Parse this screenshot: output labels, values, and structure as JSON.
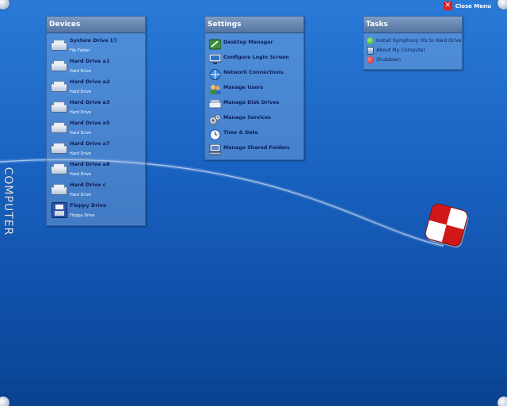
{
  "close_menu": {
    "label": "Close Menu"
  },
  "side_label": "COMPUTER",
  "devices": {
    "title": "Devices",
    "items": [
      {
        "name": "System Drive (/)",
        "sub": "File Folder",
        "icon": "hard-drive-icon"
      },
      {
        "name": "Hard Drive a1",
        "sub": "Hard Drive",
        "icon": "hard-drive-icon"
      },
      {
        "name": "Hard Drive a2",
        "sub": "Hard Drive",
        "icon": "hard-drive-icon"
      },
      {
        "name": "Hard Drive a3",
        "sub": "Hard Drive",
        "icon": "hard-drive-icon"
      },
      {
        "name": "Hard Drive a5",
        "sub": "Hard Drive",
        "icon": "hard-drive-icon"
      },
      {
        "name": "Hard Drive a7",
        "sub": "Hard Drive",
        "icon": "hard-drive-icon"
      },
      {
        "name": "Hard Drive a8",
        "sub": "Hard Drive",
        "icon": "hard-drive-icon"
      },
      {
        "name": "Hard Drive c",
        "sub": "Hard Drive",
        "icon": "hard-drive-icon"
      },
      {
        "name": "Floppy Drive",
        "sub": "Floppy Drive",
        "icon": "floppy-disk-icon"
      }
    ]
  },
  "settings": {
    "title": "Settings",
    "items": [
      {
        "name": "Desktop Manager",
        "icon": "desktop-manager-icon"
      },
      {
        "name": "Configure Login Screen",
        "icon": "monitor-icon"
      },
      {
        "name": "Network Connections",
        "icon": "network-icon"
      },
      {
        "name": "Manage Users",
        "icon": "users-icon"
      },
      {
        "name": "Manage Disk Drives",
        "icon": "disk-drive-icon"
      },
      {
        "name": "Manage Services",
        "icon": "gears-icon"
      },
      {
        "name": "Time & Date",
        "icon": "clock-icon"
      },
      {
        "name": "Manage Shared Folders",
        "icon": "shared-folder-icon"
      }
    ]
  },
  "tasks": {
    "title": "Tasks",
    "items": [
      {
        "name": "Install Symphony OS to Hard Drive",
        "icon": "install-icon"
      },
      {
        "name": "About My Computer",
        "icon": "computer-icon"
      },
      {
        "name": "Shutdown",
        "icon": "shutdown-icon"
      }
    ]
  },
  "colors": {
    "background": "#1a63c2",
    "panel_header": "#5b7ca6",
    "item_text": "#0b1f5a",
    "logo_red": "#d01818"
  }
}
